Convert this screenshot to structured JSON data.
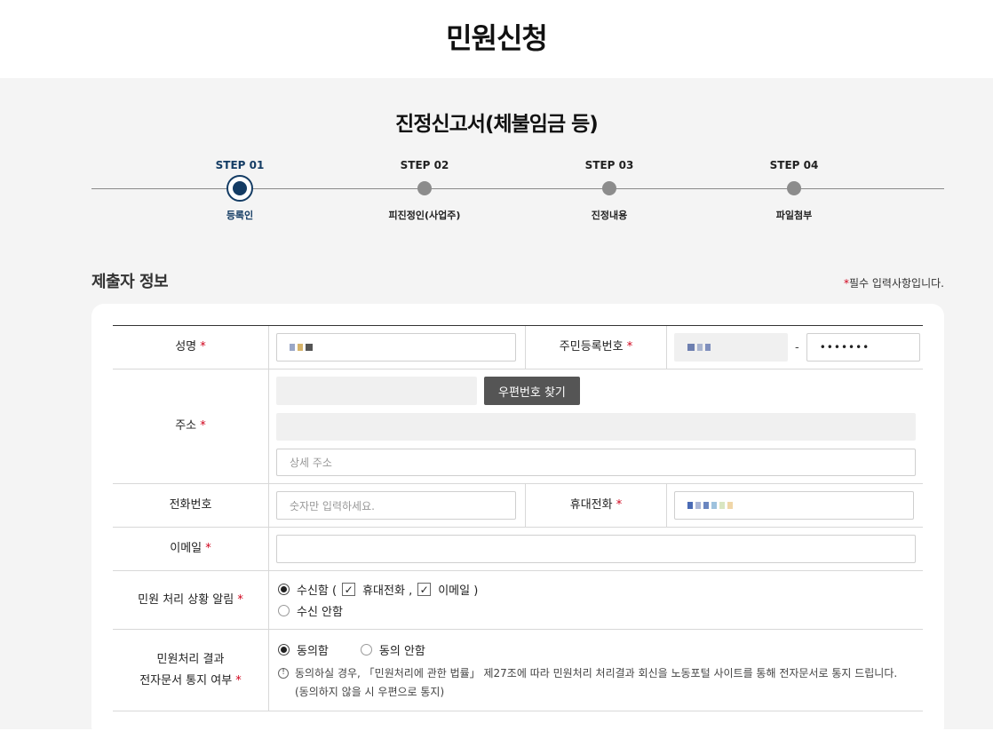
{
  "page_title": "민원신청",
  "form_title": "진정신고서(체불임금 등)",
  "steps": [
    {
      "label": "STEP 01",
      "name": "등록인"
    },
    {
      "label": "STEP 02",
      "name": "피진정인(사업주)"
    },
    {
      "label": "STEP 03",
      "name": "진정내용"
    },
    {
      "label": "STEP 04",
      "name": "파일첨부"
    }
  ],
  "section_title": "제출자 정보",
  "required_note": {
    "star": "*",
    "text": "필수 입력사항입니다."
  },
  "required_mark": "*",
  "fields": {
    "name_label": "성명",
    "rrn_label": "주민등록번호",
    "rrn_separator": "-",
    "rrn_back_value": "•••••••",
    "address_label": "주소",
    "postcode_button": "우편번호 찾기",
    "address_detail_placeholder": "상세 주소",
    "phone_label": "전화번호",
    "phone_placeholder": "숫자만 입력하세요.",
    "mobile_label": "휴대전화",
    "email_label": "이메일",
    "notify_label": "민원 처리 상황 알림",
    "notify_receive": "수신함 (",
    "notify_mobile": "휴대전화 ,",
    "notify_email": "이메일 )",
    "notify_reject": "수신 안함",
    "result_label_line1": "민원처리 결과",
    "result_label_line2": "전자문서 통지 여부",
    "result_agree": "동의함",
    "result_disagree": "동의 안함",
    "result_note_line1": "동의하실 경우, 「민원처리에 관한 법률」 제27조에 따라 민원처리 처리결과 회신을 노동포털 사이트를 통해 전자문서로 통지 드립니다.",
    "result_note_line2": "(동의하지 않을 시 우편으로 통지)"
  },
  "colors": {
    "accent": "#143c64",
    "required": "#d0021b",
    "step_inactive": "#8c8c8c"
  }
}
